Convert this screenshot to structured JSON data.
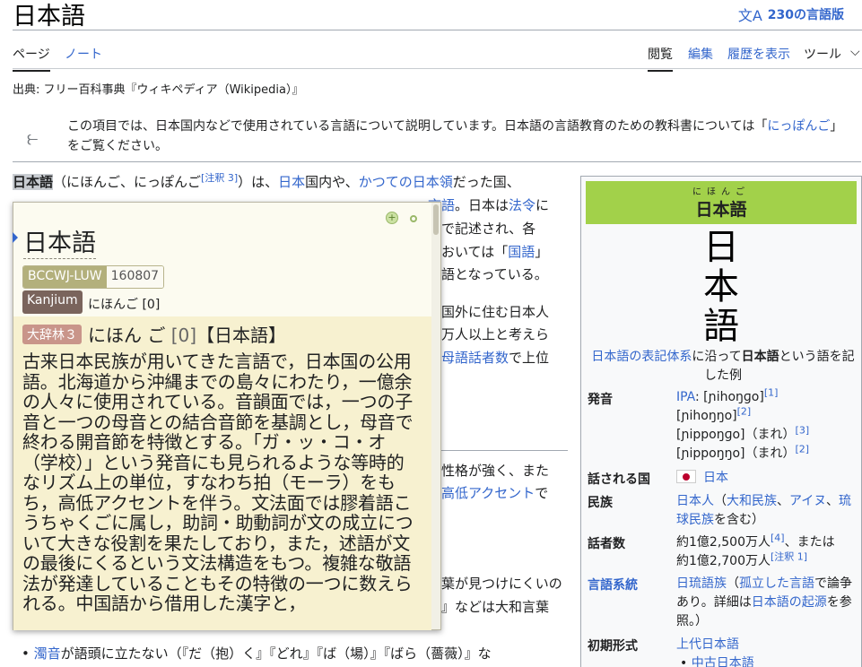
{
  "page": {
    "title": "日本語",
    "language_button": "230の言語版",
    "from": "出典: フリー百科事典『ウィキペディア（Wikipedia）』"
  },
  "tabs": {
    "page": "ページ",
    "talk": "ノート",
    "read": "閲覧",
    "edit": "編集",
    "history": "履歴を表示",
    "tools": "ツール"
  },
  "hatnote": {
    "text": "この項目では、日本国内などで使用されている言語について説明しています。日本語の言語教育のための教科書については「",
    "link": "にっぽんご",
    "tail": "」をご覧ください。"
  },
  "article": {
    "lead_bold": "日本語",
    "lead_reading": "（にほんご、にっぽんご",
    "lead_note": "[注釈 3]",
    "lead_close": "）は、",
    "link_japan": "日本",
    "lead_mid": "国内や、",
    "link_former": "かつての日本領",
    "lead_end": "だった国、",
    "l2_a": "言語",
    "l2_b": "。日本は",
    "l2_link": "法令",
    "l2_c": "に",
    "l3": "で記述され、各",
    "l4_a": "おいては「",
    "l4_link": "国語",
    "l4_b": "」",
    "l5": "語となっている。",
    "l6": "国外に住む日本人",
    "l7": "万人以上と考えら",
    "l8_link": "母語話者数",
    "l8_b": "で上位",
    "l9": "性格が強く、また",
    "l10_link": "高低アクセント",
    "l10_b": "で",
    "l11": "葉が見つけにくいの",
    "l12": "』などは大和言葉",
    "bullet_link": "濁音",
    "bullet_text": "が語頭に立たない（『だ（抱）く』『どれ』『ば（場）』『ばら（薔薇）』な"
  },
  "infobox": {
    "ruby": "にほんご",
    "name": "日本語",
    "calligraphy": [
      "日",
      "本",
      "語"
    ],
    "caption_link": "日本語の表記体系",
    "caption_a": "に沿って",
    "caption_bold": "日本語",
    "caption_b": "という語を記した例",
    "rows": {
      "pron_label": "発音",
      "pron_ipa": "IPA",
      "pron_1": ": [ɲihoŋɡo]",
      "pron_1_ref": "[1]",
      "pron_2": "[ɲihoŋŋo]",
      "pron_2_ref": "[2]",
      "pron_3": "[ɲippoŋɡo]（まれ）",
      "pron_3_ref": "[3]",
      "pron_4": "[ɲippoŋŋo]（まれ）",
      "pron_4_ref": "[2]",
      "country_label": "話される国",
      "country": "日本",
      "ethnic_label": "民族",
      "ethnic_link1": "日本人",
      "ethnic_paren": "（",
      "ethnic_link2": "大和民族",
      "ethnic_sep1": "、",
      "ethnic_link3": "アイヌ",
      "ethnic_sep2": "、",
      "ethnic_link4": "琉球民族",
      "ethnic_tail": "を含む）",
      "speakers_label": "話者数",
      "speakers_1": "約1億2,500万人",
      "speakers_1_ref": "[4]",
      "speakers_mid": "、または",
      "speakers_2": "約1億2,700万人",
      "speakers_2_ref": "[注釈 1]",
      "family_label": "言語系統",
      "family_link": "日琉語族",
      "family_paren": "（",
      "family_link2": "孤立した言語",
      "family_a": "で論争あり。詳細は",
      "family_link3": "日本語の起源",
      "family_b": "を参照。）",
      "early_label": "初期形式",
      "early_1": "上代日本語",
      "early_2": "中古日本語"
    }
  },
  "popup": {
    "word": "日本語",
    "tag_key": "BCCWJ-LUW",
    "tag_value": "160807",
    "kanjium": "Kanjium",
    "reading": "にほんご [0]",
    "dict_tag": "大辞林３",
    "headword": "にほん ご",
    "accent": "[0]",
    "headword_kanji": "【日本語】",
    "definition": "古来日本民族が用いてきた言語で，日本国の公用語。北海道から沖縄までの島々にわたり，一億余の人々に使用されている。音韻面では，一つの子音と一つの母音との結合音節を基調とし，母音で終わる開音節を特徴とする。「ガ・ッ・コ・オ（学校）」という発音にも見られるような等時的なリズム上の単位，すなわち拍（モーラ）をもち，高低アクセントを伴う。文法面では膠着語こうちゃくごに属し，助詞・助動詞が文の成立について大きな役割を果たしており，また，述語が文の最後にくるという文法構造をもつ。複雑な敬語法が発達していることもその特徴の一つに数えられる。中国語から借用した漢字と，"
  }
}
